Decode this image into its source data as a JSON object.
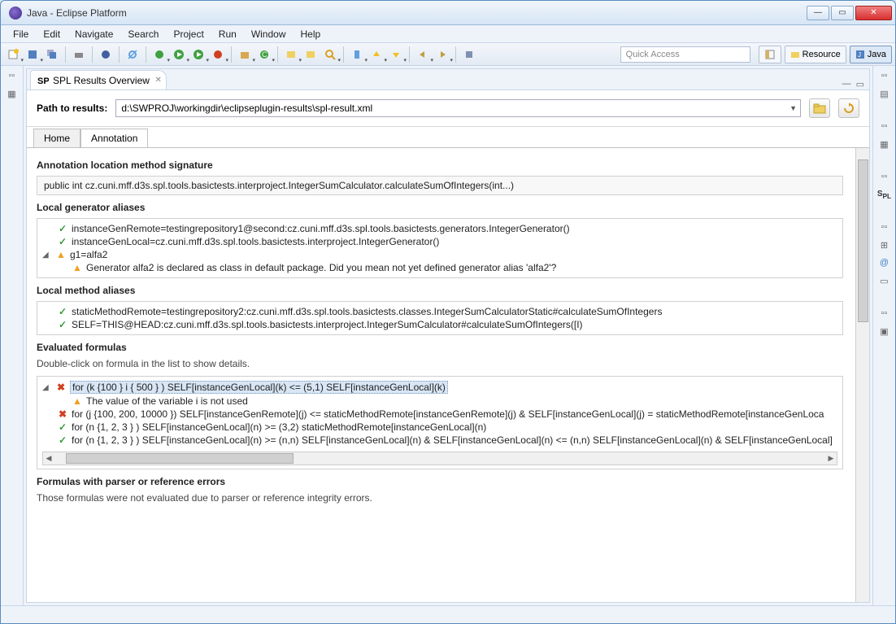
{
  "window": {
    "title": "Java - Eclipse Platform"
  },
  "menu": [
    "File",
    "Edit",
    "Navigate",
    "Search",
    "Project",
    "Run",
    "Window",
    "Help"
  ],
  "quickaccess": "Quick Access",
  "perspectives": {
    "resource": "Resource",
    "java": "Java"
  },
  "view": {
    "tab": "SPL Results Overview"
  },
  "path": {
    "label": "Path to results:",
    "value": "d:\\SWPROJ\\workingdir\\eclipseplugin-results\\spl-result.xml"
  },
  "innertabs": {
    "home": "Home",
    "annotation": "Annotation"
  },
  "sections": {
    "sig_h": "Annotation location method signature",
    "sig": "public int cz.cuni.mff.d3s.spl.tools.basictests.interproject.IntegerSumCalculator.calculateSumOfIntegers(int...)",
    "gen_h": "Local generator aliases",
    "gen": [
      "instanceGenRemote=testingrepository1@second:cz.cuni.mff.d3s.spl.tools.basictests.generators.IntegerGenerator()",
      "instanceGenLocal=cz.cuni.mff.d3s.spl.tools.basictests.interproject.IntegerGenerator()",
      "g1=alfa2",
      "Generator alfa2 is declared as class in default package. Did you mean not yet defined generator alias 'alfa2'?"
    ],
    "meth_h": "Local method aliases",
    "meth": [
      "staticMethodRemote=testingrepository2:cz.cuni.mff.d3s.spl.tools.basictests.classes.IntegerSumCalculatorStatic#calculateSumOfIntegers",
      "SELF=THIS@HEAD:cz.cuni.mff.d3s.spl.tools.basictests.interproject.IntegerSumCalculator#calculateSumOfIntegers([I)"
    ],
    "form_h": "Evaluated formulas",
    "form_note": "Double-click on formula in the list to show details.",
    "form": [
      "for (k {100 } i { 500 } ) SELF[instanceGenLocal](k) <= (5,1) SELF[instanceGenLocal](k)",
      "The value of the variable i is not used",
      "for (j {100, 200, 10000 }) SELF[instanceGenRemote](j) <= staticMethodRemote[instanceGenRemote](j) & SELF[instanceGenLocal](j) = staticMethodRemote[instanceGenLoca",
      "for (n {1, 2, 3 } ) SELF[instanceGenLocal](n) >= (3,2) staticMethodRemote[instanceGenLocal](n)",
      "for (n {1, 2, 3 } ) SELF[instanceGenLocal](n) >= (n,n) SELF[instanceGenLocal](n) & SELF[instanceGenLocal](n) <= (n,n) SELF[instanceGenLocal](n) & SELF[instanceGenLocal]"
    ],
    "err_h": "Formulas with parser or reference errors",
    "err_note": "Those formulas were not evaluated due to parser or reference integrity errors."
  }
}
